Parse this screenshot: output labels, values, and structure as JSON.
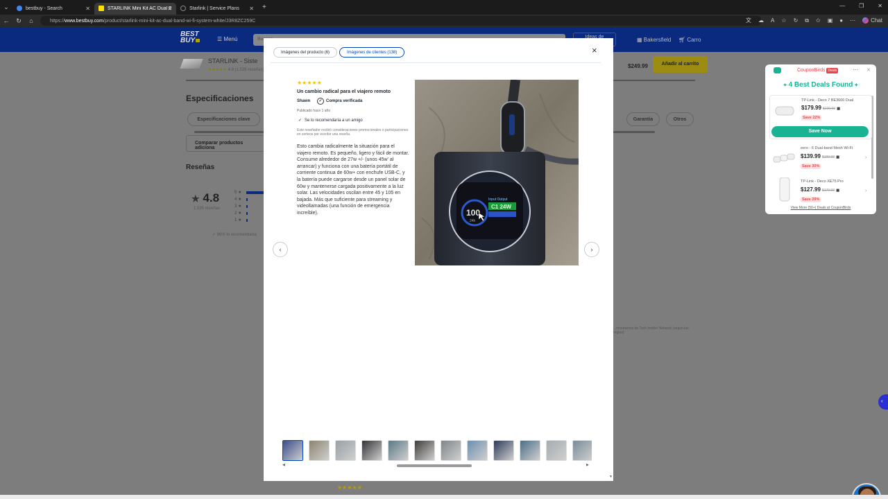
{
  "browser": {
    "tabs": [
      {
        "title": "bestbuy - Search",
        "active": false,
        "favicon_color": "#4285f4"
      },
      {
        "title": "STARLINK Mini Kit AC Dual Band W",
        "active": true,
        "favicon_color": "#ffe000"
      },
      {
        "title": "Starlink | Service Plans",
        "active": false,
        "favicon_color": "#888888"
      }
    ],
    "url_prefix": "https://",
    "url_host": "www.bestbuy.com",
    "url_path": "/product/starlink-mini-kit-ac-dual-band-wi-fi-system-white/J3R8ZC259C",
    "chat_label": "Chat"
  },
  "bestbuy": {
    "logo_line1": "BEST",
    "logo_line2": "BUY",
    "menu_label": "Menú",
    "search_placeholder": "Buscar",
    "ideas_label": "Ideas de",
    "store_label": "Bakersfield",
    "cart_label": "Carro",
    "product_name": "STARLINK - Siste",
    "product_rating": "4.8 (1,535 reseñas)",
    "product_price": "$249.99",
    "add_to_cart": "Añadir al carrito",
    "specs_title": "Especificaciones",
    "spec_key": "Especificaciones clave",
    "spec_guarantee": "Garantía",
    "spec_other": "Otros",
    "compare_label": "Comparar productos adiciona",
    "reviews_title": "Reseñas",
    "overall_rating": "4.8",
    "overall_count": "1,535 reseñas",
    "rating_bars": [
      {
        "label": "5",
        "fraction": 0.9
      },
      {
        "label": "4",
        "fraction": 0.06
      },
      {
        "label": "3",
        "fraction": 0.02
      },
      {
        "label": "2",
        "fraction": 0.01
      },
      {
        "label": "1",
        "fraction": 0.02
      }
    ],
    "recommend_note": "96% lo recomendaría",
    "side_note": "...mostrarnos de Tech Insider Network (según las reglas)."
  },
  "modal": {
    "tab_product": "Imágenes del producto (6)",
    "tab_customer": "Imágenes de clientes (138)",
    "close": "×",
    "review": {
      "stars": "★★★★★",
      "title": "Un cambio radical para el viajero remoto",
      "author": "Shawn",
      "verified": "Compra verificada",
      "date": "Publicado hace 1 año",
      "recommend": "Se lo recomendaría a un amigo",
      "disclaimer": "Este reseñador recibió consideraciones promocionales o participaciones en sorteos por escribir una reseña.",
      "body": "Esto cambia radicalmente la situación para el viajero remoto. Es pequeño, ligero y fácil de montar. Consume alrededor de 27w +/- (unos 45w' al arrancar) y funciona con una batería portátil de corriente continua de 60w+ con enchufe USB-C, y la batería puede cargarse desde un panel solar de 60w y mantenerse cargada positivamente a la luz solar. Las velocidades oscilan entre 45 y 105 en bajada. Más que suficiente para streaming y videollamadas (una función de emergencia increíble)."
    },
    "photo": {
      "screen_value": "100",
      "screen_unit": "24h",
      "screen_label": "Input Output",
      "screen_power": "C1 24W"
    },
    "prev": "‹",
    "next": "›",
    "thumb_colors": [
      "#3a4d8a",
      "#8b8670",
      "#9aa0a5",
      "#333438",
      "#5c7a86",
      "#403e3a",
      "#7f8689",
      "#6d8fb0",
      "#2d3b5a",
      "#4b6f88",
      "#a6acb0",
      "#7a8c99"
    ]
  },
  "coupon": {
    "brand": "CouponBirds",
    "brand_tag": "Deals",
    "headline": "4 Best Deals Found",
    "items": [
      {
        "name": "TP-Link - Deco 7 BE3600 Dual",
        "price": "$179.99",
        "old": "$229.99",
        "save": "Save 22%"
      },
      {
        "name": "eero - 6 Dual-band Mesh Wi-Fi",
        "price": "$139.99",
        "old": "$199.99",
        "save": "Save 30%"
      },
      {
        "name": "TP-Link - Deco XE75 Pro",
        "price": "$127.99",
        "old": "$179.99",
        "save": "Save 29%"
      }
    ],
    "save_now": "Save Now",
    "view_more": "View More (50+) Deals at CouponBirds"
  }
}
